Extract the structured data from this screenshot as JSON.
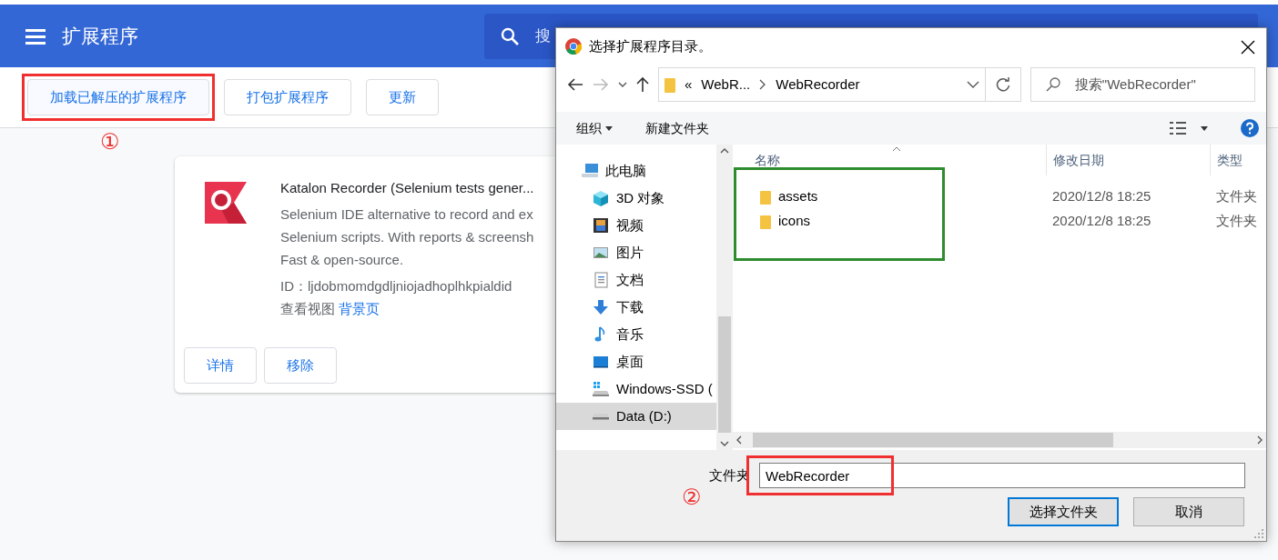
{
  "header": {
    "title": "扩展程序",
    "search_placeholder": "搜"
  },
  "toolbar": {
    "buttons": [
      {
        "label": "加载已解压的扩展程序",
        "annotated": true,
        "step": "①"
      },
      {
        "label": "打包扩展程序",
        "annotated": false
      },
      {
        "label": "更新",
        "annotated": false
      }
    ]
  },
  "extension": {
    "name": "Katalon Recorder (Selenium tests gener...",
    "description": [
      "Selenium IDE alternative to record and ex",
      "Selenium scripts. With reports & screensh",
      "Fast & open-source."
    ],
    "id": "ID：ljdobmomdgdljniojadhoplhkpialdid",
    "views_label": "查看视图",
    "views_link": "背景页",
    "buttons": [
      "详情",
      "移除"
    ]
  },
  "dialog": {
    "title": "选择扩展程序目录。",
    "path_overflow": "«",
    "path": [
      "WebR...",
      "WebRecorder"
    ],
    "search_placeholder": "搜索\"WebRecorder\"",
    "commands": [
      "组织",
      "新建文件夹"
    ],
    "nav": [
      {
        "label": "此电脑",
        "kind": "pc",
        "selected": false
      },
      {
        "label": "3D 对象",
        "kind": "cube",
        "selected": false
      },
      {
        "label": "视频",
        "kind": "video",
        "selected": false
      },
      {
        "label": "图片",
        "kind": "image",
        "selected": false
      },
      {
        "label": "文档",
        "kind": "doc",
        "selected": false
      },
      {
        "label": "下载",
        "kind": "download",
        "selected": false
      },
      {
        "label": "音乐",
        "kind": "music",
        "selected": false
      },
      {
        "label": "桌面",
        "kind": "desktop",
        "selected": false
      },
      {
        "label": "Windows-SSD (",
        "kind": "windrive",
        "selected": false
      },
      {
        "label": "Data (D:)",
        "kind": "drive",
        "selected": true
      }
    ],
    "columns": [
      "名称",
      "修改日期",
      "类型"
    ],
    "files_annotated": true,
    "files": [
      {
        "name": "assets",
        "date": "2020/12/8 18:25",
        "type": "文件夹"
      },
      {
        "name": "icons",
        "date": "2020/12/8 18:25",
        "type": "文件夹"
      }
    ],
    "folder_label": "文件夹",
    "folder_value": "WebRecorder",
    "folder_annotated": true,
    "folder_step": "②",
    "buttons": [
      {
        "label": "选择文件夹",
        "primary": true
      },
      {
        "label": "取消",
        "primary": false
      }
    ]
  }
}
